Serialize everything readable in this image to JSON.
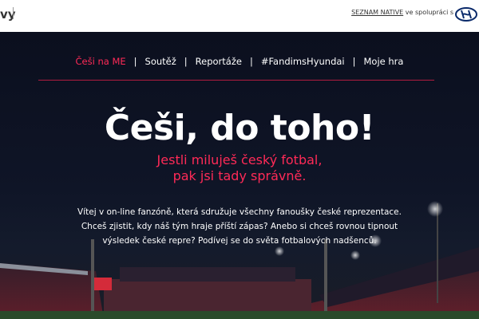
{
  "topbar": {
    "logo_fragment": "vy",
    "partner_link": "SEZNAM NATIVE",
    "partner_suffix": " ve spolupráci s",
    "brand_icon": "hyundai-logo-icon"
  },
  "nav": {
    "items": [
      "Češi na ME",
      "Soutěž",
      "Reportáže",
      "#FandimsHyundai",
      "Moje hra"
    ],
    "separator": "|",
    "active_index": 0
  },
  "hero": {
    "title": "Češi, do toho!",
    "subtitle_line1": "Jestli miluješ český fotbal,",
    "subtitle_line2": "pak jsi tady správně.",
    "intro": "Vítej v on-line fanzóně, která sdružuje všechny fanoušky české reprezentace. Chceš zjistit, kdy náš tým hraje příští zápas? Anebo si chceš rovnou tipnout výsledek české repre? Podívej se do světa fotbalových nadšenců."
  },
  "colors": {
    "accent": "#ff2a57",
    "hero_bg": "#0b0f1e",
    "text": "#ffffff"
  }
}
